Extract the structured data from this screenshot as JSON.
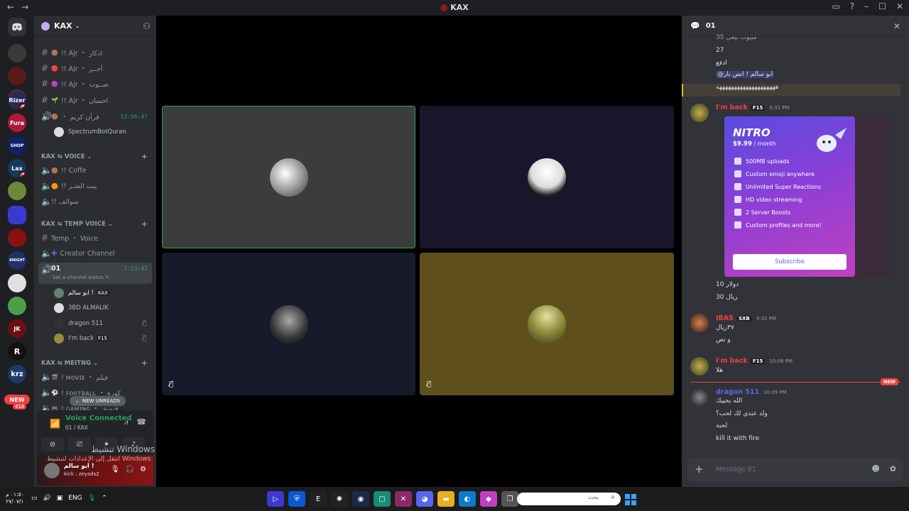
{
  "window": {
    "title": "KAX",
    "nav_back": "←",
    "nav_forward": "→",
    "right_icons": [
      "▭",
      "?",
      "–",
      "☐",
      "✕"
    ]
  },
  "rail": {
    "servers": [
      {
        "label": "",
        "color": "#5865f2",
        "icon": "discord-logo-icon"
      },
      {
        "label": "",
        "color": "#3a3a3a"
      },
      {
        "label": "",
        "color": "#5a1a1a"
      },
      {
        "label": "",
        "color": "#6a2a2a"
      },
      {
        "label": "Rizer",
        "color": "#2a2a5a",
        "badge": "5"
      },
      {
        "label": "Fura",
        "color": "#b0183a"
      },
      {
        "label": "SHOP",
        "color": "#10206a"
      },
      {
        "label": "Lax",
        "color": "#123a5a",
        "badge": "1"
      },
      {
        "label": "",
        "color": "#6a8a3a"
      },
      {
        "label": "",
        "color": "#3a3ad0"
      },
      {
        "label": "",
        "color": "#8a1010"
      },
      {
        "label": "KNIGHT",
        "color": "#20306a"
      },
      {
        "label": "",
        "color": "#e0e0e0"
      },
      {
        "label": "",
        "color": "#4aa04a"
      },
      {
        "label": "JK",
        "color": "#6a1010"
      },
      {
        "label": "R",
        "color": "#111"
      },
      {
        "label": "krz",
        "color": "#1a3a6a"
      }
    ],
    "new_pill": "NEW",
    "count": "416"
  },
  "server": {
    "name": "KAX"
  },
  "channels": [
    {
      "name": "!! Ajr ・ اذكار",
      "type": "text"
    },
    {
      "name": "!! Ajr ・ أجــر",
      "type": "text"
    },
    {
      "name": "!! Ajr ・ صــوت",
      "type": "text"
    },
    {
      "name": "!! Ajr ・ احسان",
      "type": "text"
    },
    {
      "name": "・ قرآن كريم",
      "type": "voice",
      "time": "13:56:47"
    }
  ],
  "bot_member": "SpectrumBotQuran",
  "categories": {
    "voice": "KAX ⇆ VOICE",
    "temp": "KAX ⇆ TEMP VOICE",
    "meeting": "KAX ⇆ MEITNG"
  },
  "voice_channels": [
    {
      "name": "!! Coffe"
    },
    {
      "name": "!! بيت الشـر"
    },
    {
      "name": "!! سوالف"
    }
  ],
  "temp_channels": [
    {
      "name": "Temp ・ Voice",
      "type": "text"
    },
    {
      "name": "Creator Channel",
      "type": "voice"
    }
  ],
  "active_channel": {
    "name": "01",
    "time": "1:23:42",
    "status": "Set a channel status"
  },
  "members": [
    {
      "name": "ابو سالم !",
      "tag": "KAX",
      "color": "#777"
    },
    {
      "name": "3BD ALMALIK",
      "tag": "",
      "color": "#ddd"
    },
    {
      "name": "dragon 511",
      "tag": "",
      "color": "#333",
      "muted": "true"
    },
    {
      "name": "I'm back",
      "tag": "F15",
      "color": "#9a8a3a",
      "muted": "true"
    }
  ],
  "meeting_channels": [
    {
      "name": "! ᴍᴏᴠɪᴇ ・ فيلم"
    },
    {
      "name": "! ꜰᴏᴏᴛʙᴀʟʟ ・ كورة"
    },
    {
      "name": "! ɢᴀᴍɪɴɢ ・ قيمنق"
    }
  ],
  "new_unreads": "NEW UNREADS",
  "voice_panel": {
    "title": "Voice Connected",
    "subtitle": "01 / KAX"
  },
  "user": {
    "name": "ابو سالم !",
    "status": "kick : zeyads2"
  },
  "watermark": {
    "line1": "تنشيط Windows",
    "line2": "انتقل إلى الإعدادات لتنشيط Windows"
  },
  "stage": {
    "tiles": [
      {
        "bg": "#3b3c3c",
        "avatar": "#cfcfcf",
        "speaking": "true"
      },
      {
        "bg": "#17162a",
        "avatar": "#f0f0f0"
      },
      {
        "bg": "#171a2b",
        "avatar": "#2a2a3a",
        "muted": "true"
      },
      {
        "bg": "#5f4f1c",
        "avatar": "#8a8a3a",
        "muted": "true"
      }
    ]
  },
  "chat": {
    "channel": "01",
    "lines_top": [
      "مبيوب بيعي 35",
      "27",
      "ادفع"
    ],
    "highlight_text": "@ابو سالم ! انص نار",
    "line_ha": "ههههههههههههههههههههه",
    "msg1": {
      "author": "I'm back",
      "tag": "F15",
      "time": "9:31 PM",
      "author_color": "#f23f42"
    },
    "nitro": {
      "logo": "NITRO",
      "price": "$9.99",
      "per": " / month",
      "perks": [
        "500MB uploads",
        "Custom emoji anywhere",
        "Unlimited Super Reactions",
        "HD video streaming",
        "2 Server Boosts",
        "Custom profiles and more!"
      ],
      "subscribe": "Subscribe"
    },
    "after_nitro": [
      "10 دولار",
      "30 ريال"
    ],
    "msg2": {
      "author": "IBAS",
      "tag": "SXB",
      "time": "9:32 PM",
      "author_color": "#f23f42",
      "lines": [
        "٣٧ريال",
        "و نص"
      ]
    },
    "msg3": {
      "author": "I'm back",
      "tag": "F15",
      "time": "10:06 PM",
      "author_color": "#f23f42",
      "lines": [
        "هلا"
      ]
    },
    "new_tag": "NEW",
    "msg4": {
      "author": "dragon 511",
      "time": "10:09 PM",
      "author_color": "#5865f2",
      "lines": [
        "الله يحييك",
        "ولد عندي لك لحب؟",
        "لحبة",
        "kill it with fire"
      ]
    },
    "composer_placeholder": "Message 01"
  },
  "taskbar": {
    "time": "٠١:٥٠ م",
    "date": "٢٧/٠٧/١",
    "lang": "ENG",
    "search_placeholder": "بحث"
  }
}
